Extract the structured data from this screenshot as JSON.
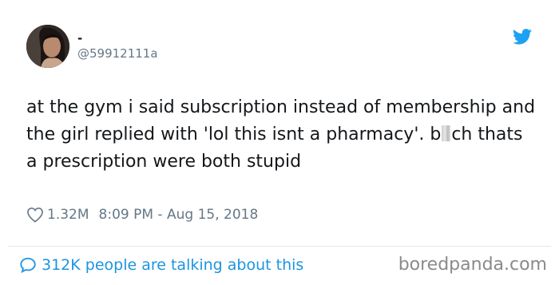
{
  "user": {
    "display_name": "-",
    "handle": "@59912111a"
  },
  "tweet": {
    "text_part1": "at the gym i said subscription instead of membership and the girl replied with 'lol this isnt a pharmacy'. b",
    "text_part2": "ch thats a prescription were both stupid",
    "likes": "1.32M",
    "timestamp": "8:09 PM - Aug 15, 2018"
  },
  "footer": {
    "conversation_text": "312K people are talking about this"
  },
  "watermark": "boredpanda.com",
  "icons": {
    "brand": "twitter-bird-icon",
    "like": "heart-icon",
    "conversation": "speech-bubble-icon"
  },
  "colors": {
    "twitter_blue": "#1da1f2",
    "link_blue": "#1b95e0",
    "text": "#14171a",
    "muted": "#657786",
    "divider": "#e1e8ed"
  }
}
